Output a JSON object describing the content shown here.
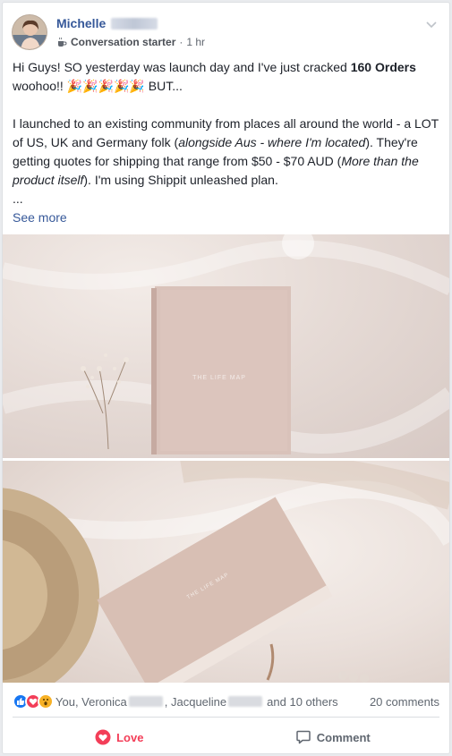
{
  "post": {
    "author_name": "Michelle",
    "badge": "Conversation starter",
    "time": "1 hr",
    "line1": "Hi Guys! SO yesterday was launch day and I've just cracked ",
    "orders_bold": "160 Orders",
    "line2": " woohoo!! 🎉🎉🎉🎉🎉 BUT...",
    "para_start": "I launched to an existing community from places all around the world - a LOT of US, UK and Germany folk (",
    "para_italic1": "alongside Aus - where I'm located",
    "para_mid": "). They're getting quotes for shipping that range from $50 - $70 AUD (",
    "para_italic2": "More than the product itself",
    "para_end": "). I'm using Shippit unleashed plan.",
    "ellipsis": "...",
    "see_more": "See more"
  },
  "images": {
    "photo1_book_title": "THE LIFE MAP",
    "photo2_book_title": "THE LIFE MAP"
  },
  "reactions": {
    "icons": [
      "like-icon",
      "love-icon",
      "wow-icon"
    ],
    "names_prefix": "You, Veronica",
    "names_mid": ", Jacqueline",
    "names_suffix": "and 10 others",
    "comments": "20 comments"
  },
  "actions": {
    "love_label": "Love",
    "comment_label": "Comment"
  },
  "colors": {
    "link": "#365899",
    "love": "#f33e58",
    "like": "#1877f2",
    "wow": "#f7b125"
  }
}
